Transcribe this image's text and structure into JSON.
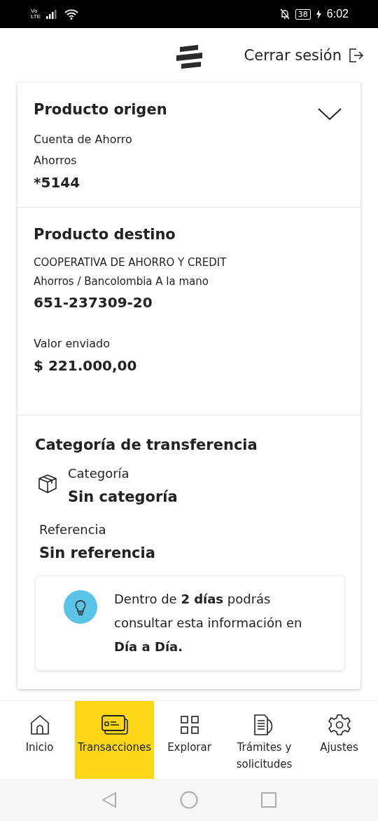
{
  "status_bar": {
    "network_top": "Vo",
    "network_bottom": "LTE",
    "battery": "38",
    "time": "6:02"
  },
  "header": {
    "logout": "Cerrar sesión"
  },
  "origin": {
    "title": "Producto origen",
    "expanded": false,
    "lines": [
      "Cuenta de Ahorro",
      "Ahorros"
    ],
    "account": "*5144"
  },
  "destination": {
    "title": "Producto destino",
    "lines": [
      "COOPERATIVA DE AHORRO Y CREDIT",
      "Ahorros / Bancolombia A la mano"
    ],
    "account": "651-237309-20",
    "amount_label": "Valor enviado",
    "amount": "$ 221.000,00"
  },
  "category": {
    "title": "Categoría de transferencia",
    "category_label": "Categoría",
    "category_value": "Sin categoría",
    "reference_label": "Referencia",
    "reference_value": "Sin referencia",
    "info": "Dentro de **2 días** podrás consultar esta información en **Día a Día.**"
  },
  "nav": [
    {
      "label": "Inicio",
      "selected": false
    },
    {
      "label": "Transacciones",
      "selected": true
    },
    {
      "label": "Explorar",
      "selected": false
    },
    {
      "label": "Trámites y solicitudes",
      "selected": false
    },
    {
      "label": "Ajustes",
      "selected": false
    }
  ]
}
